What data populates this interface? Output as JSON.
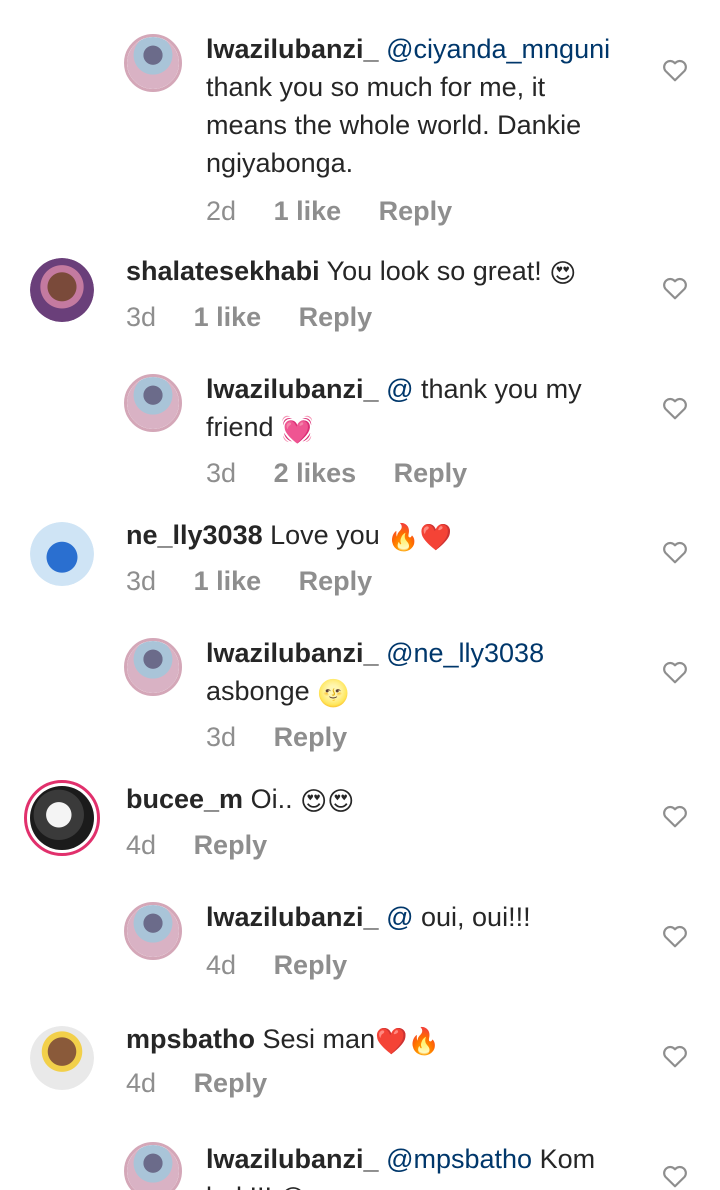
{
  "comments": [
    {
      "user": "lwazilubanzi_",
      "mention": "@ciyanda_mnguni",
      "text_lines": [
        "thank you so much for me, it",
        "means the whole world. Dankie",
        "ngiyabonga."
      ],
      "time": "2d",
      "likes": "1 like",
      "reply": "Reply",
      "emoji": ""
    },
    {
      "user": "shalatesekhabi",
      "mention": "",
      "text": "You look so great!",
      "emoji": "😍",
      "time": "3d",
      "likes": "1 like",
      "reply": "Reply"
    },
    {
      "user": "lwazilubanzi_",
      "mention": "@",
      "text": "thank you my",
      "text2": "friend",
      "emoji": "💓",
      "time": "3d",
      "likes": "2 likes",
      "reply": "Reply"
    },
    {
      "user": "ne_lly3038",
      "mention": "",
      "text": "Love you",
      "emoji": "🔥❤️",
      "time": "3d",
      "likes": "1 like",
      "reply": "Reply"
    },
    {
      "user": "lwazilubanzi_",
      "mention": "@ne_lly3038",
      "text2": "asbonge",
      "emoji": "🌝",
      "time": "3d",
      "reply": "Reply"
    },
    {
      "user": "bucee_m",
      "mention": "",
      "text": "Oi..",
      "emoji": "😍😍",
      "time": "4d",
      "reply": "Reply"
    },
    {
      "user": "lwazilubanzi_",
      "mention": "@",
      "text": "oui, oui!!!",
      "time": "4d",
      "reply": "Reply"
    },
    {
      "user": "mpsbatho",
      "mention": "",
      "text": "Sesi man",
      "emoji": "❤️🔥",
      "time": "4d",
      "reply": "Reply"
    },
    {
      "user": "lwazilubanzi_",
      "mention": "@mpsbatho",
      "text": "Kom",
      "text2": "bak!!!",
      "emoji": "😍"
    }
  ],
  "icons": {
    "like": "heart-outline-icon"
  },
  "colors": {
    "mention": "#00376b",
    "meta": "#8e8e8e",
    "text": "#262626",
    "story_ring": "#e1306c"
  }
}
